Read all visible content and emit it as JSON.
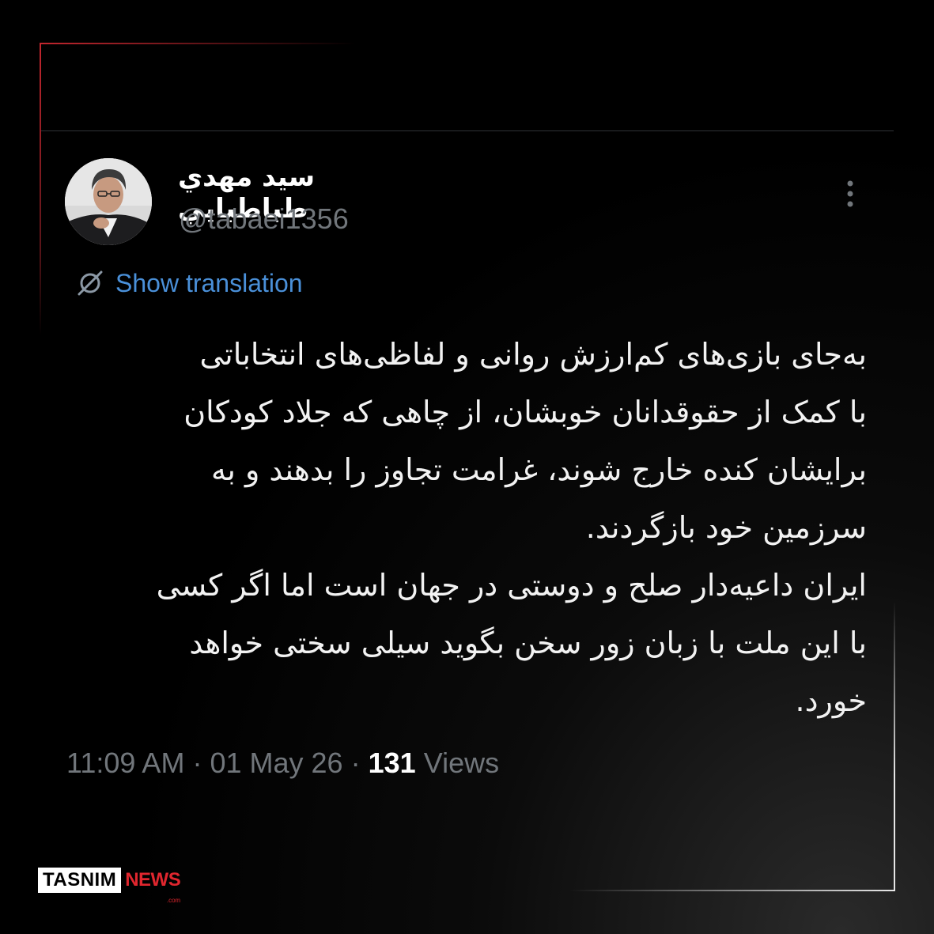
{
  "author": {
    "display_name": "سید مهدي طباطبايي",
    "handle": "@tabaei1356"
  },
  "translate": {
    "label": "Show translation",
    "icon": "globe-slash-icon"
  },
  "menu": {
    "icon": "more-vertical-icon"
  },
  "tweet": {
    "lines": [
      "به‌جای بازی‌های کم‌ارزش روانی و لفاظی‌های انتخاباتی",
      "با کمک از حقوقدانان خوبشان، از چاهی که جلاد کودکان",
      "برایشان کنده خارج شوند، غرامت تجاوز را بدهند و به",
      "سرزمین خود بازگردند.",
      "ایران داعیه‌دار صلح و دوستی در جهان است اما اگر کسی",
      "با این ملت با زبان زور سخن بگوید سیلی سختی خواهد",
      "خورد."
    ]
  },
  "meta": {
    "time": "11:09 AM",
    "separator": "·",
    "date": "01 May 26",
    "views_count": "131",
    "views_label": "Views"
  },
  "brand": {
    "name": "TASNIM",
    "suffix": "NEWS",
    "domain": ".com"
  },
  "colors": {
    "background": "#000000",
    "link": "#4a90d9",
    "secondary_text": "#71767b",
    "frame_accent": "#c2262e",
    "brand_red": "#e0262e"
  }
}
